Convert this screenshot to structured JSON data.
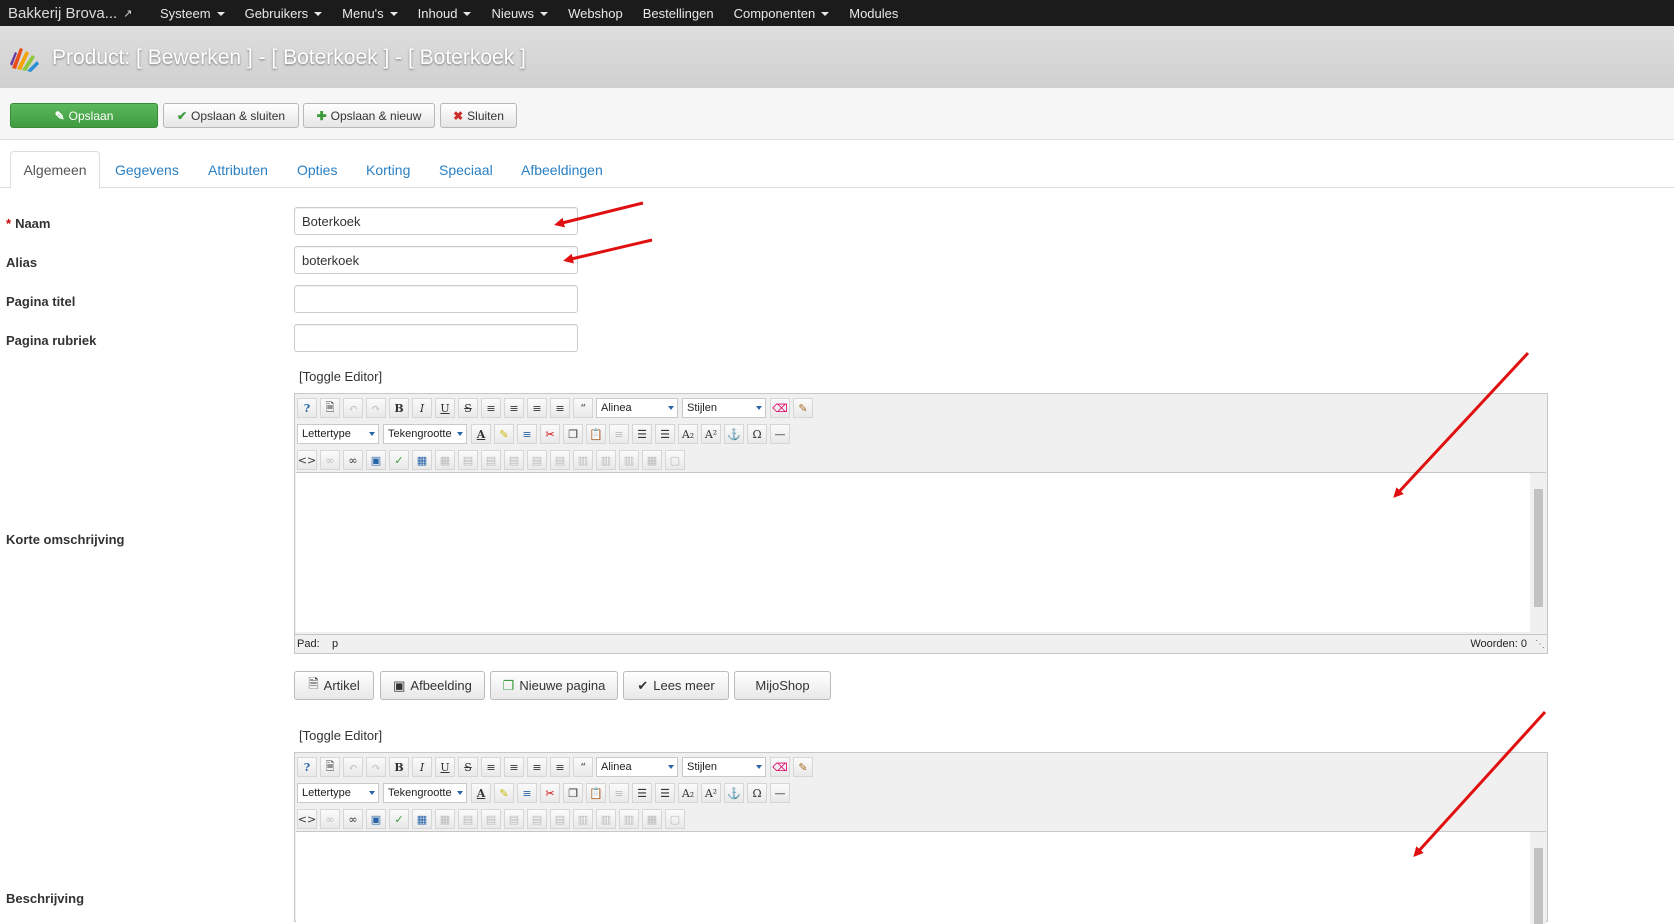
{
  "navbar": {
    "brand": "Bakkerij Brova...",
    "items": [
      {
        "label": "Systeem",
        "dropdown": true
      },
      {
        "label": "Gebruikers",
        "dropdown": true
      },
      {
        "label": "Menu's",
        "dropdown": true
      },
      {
        "label": "Inhoud",
        "dropdown": true
      },
      {
        "label": "Nieuws",
        "dropdown": true
      },
      {
        "label": "Webshop",
        "dropdown": false
      },
      {
        "label": "Bestellingen",
        "dropdown": false
      },
      {
        "label": "Componenten",
        "dropdown": true
      },
      {
        "label": "Modules",
        "dropdown": false
      }
    ]
  },
  "header": {
    "title": "Product: [ Bewerken ] - [ Boterkoek ] - [ Boterkoek ]"
  },
  "toolbar": {
    "save": "Opslaan",
    "save_close": "Opslaan & sluiten",
    "save_new": "Opslaan & nieuw",
    "close": "Sluiten"
  },
  "tabs": [
    "Algemeen",
    "Gegevens",
    "Attributen",
    "Opties",
    "Korting",
    "Speciaal",
    "Afbeeldingen"
  ],
  "form": {
    "naam_label": "Naam",
    "naam_value": "Boterkoek",
    "alias_label": "Alias",
    "alias_value": "boterkoek",
    "pagina_titel_label": "Pagina titel",
    "pagina_titel_value": "",
    "pagina_rubriek_label": "Pagina rubriek",
    "pagina_rubriek_value": "",
    "korte_label": "Korte omschrijving",
    "beschrijving_label": "Beschrijving"
  },
  "editor": {
    "toggle": "[Toggle Editor]",
    "format_select": "Alinea",
    "styles_select": "Stijlen",
    "font_select": "Lettertype",
    "size_select": "Tekengrootte",
    "path_label": "Pad:",
    "path_value": "p",
    "words": "Woorden: 0"
  },
  "editor_buttons": {
    "artikel": "Artikel",
    "afbeelding": "Afbeelding",
    "nieuwe_pagina": "Nieuwe pagina",
    "lees_meer": "Lees meer",
    "mijoshop": "MijoShop"
  },
  "colors": {
    "navbar_bg": "#1b1b1b",
    "save_green": "#4cae4c",
    "link_blue": "#2a80c4",
    "annotation_red": "#e01010"
  }
}
